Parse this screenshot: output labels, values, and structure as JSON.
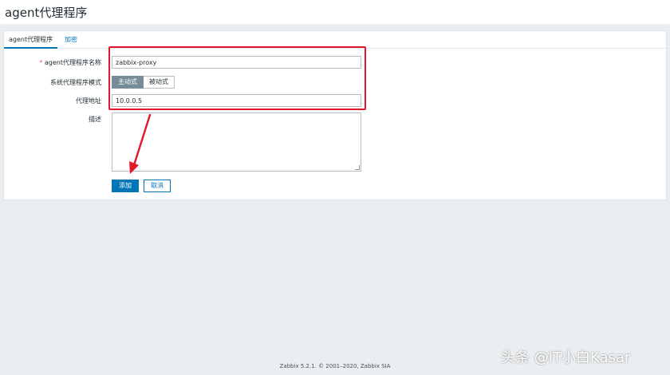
{
  "header": {
    "title": "agent代理程序"
  },
  "tabs": [
    {
      "label": "agent代理程序"
    },
    {
      "label": "加密"
    }
  ],
  "form": {
    "name": {
      "label": "agent代理程序名称",
      "required_mark": "*",
      "value": "zabbix-proxy"
    },
    "mode": {
      "label": "系统代理程序模式",
      "options": [
        "主动式",
        "被动式"
      ],
      "selected": "主动式"
    },
    "address": {
      "label": "代理地址",
      "value": "10.0.0.5"
    },
    "description": {
      "label": "描述",
      "value": ""
    },
    "buttons": {
      "add": "添加",
      "cancel": "取消"
    }
  },
  "annotation": {
    "highlight_color": "#e0182c"
  },
  "footer": {
    "text": "Zabbix 5.2.1. © 2001–2020, Zabbix SIA"
  },
  "watermark": {
    "text": "头条 @IT小白Kasar"
  }
}
